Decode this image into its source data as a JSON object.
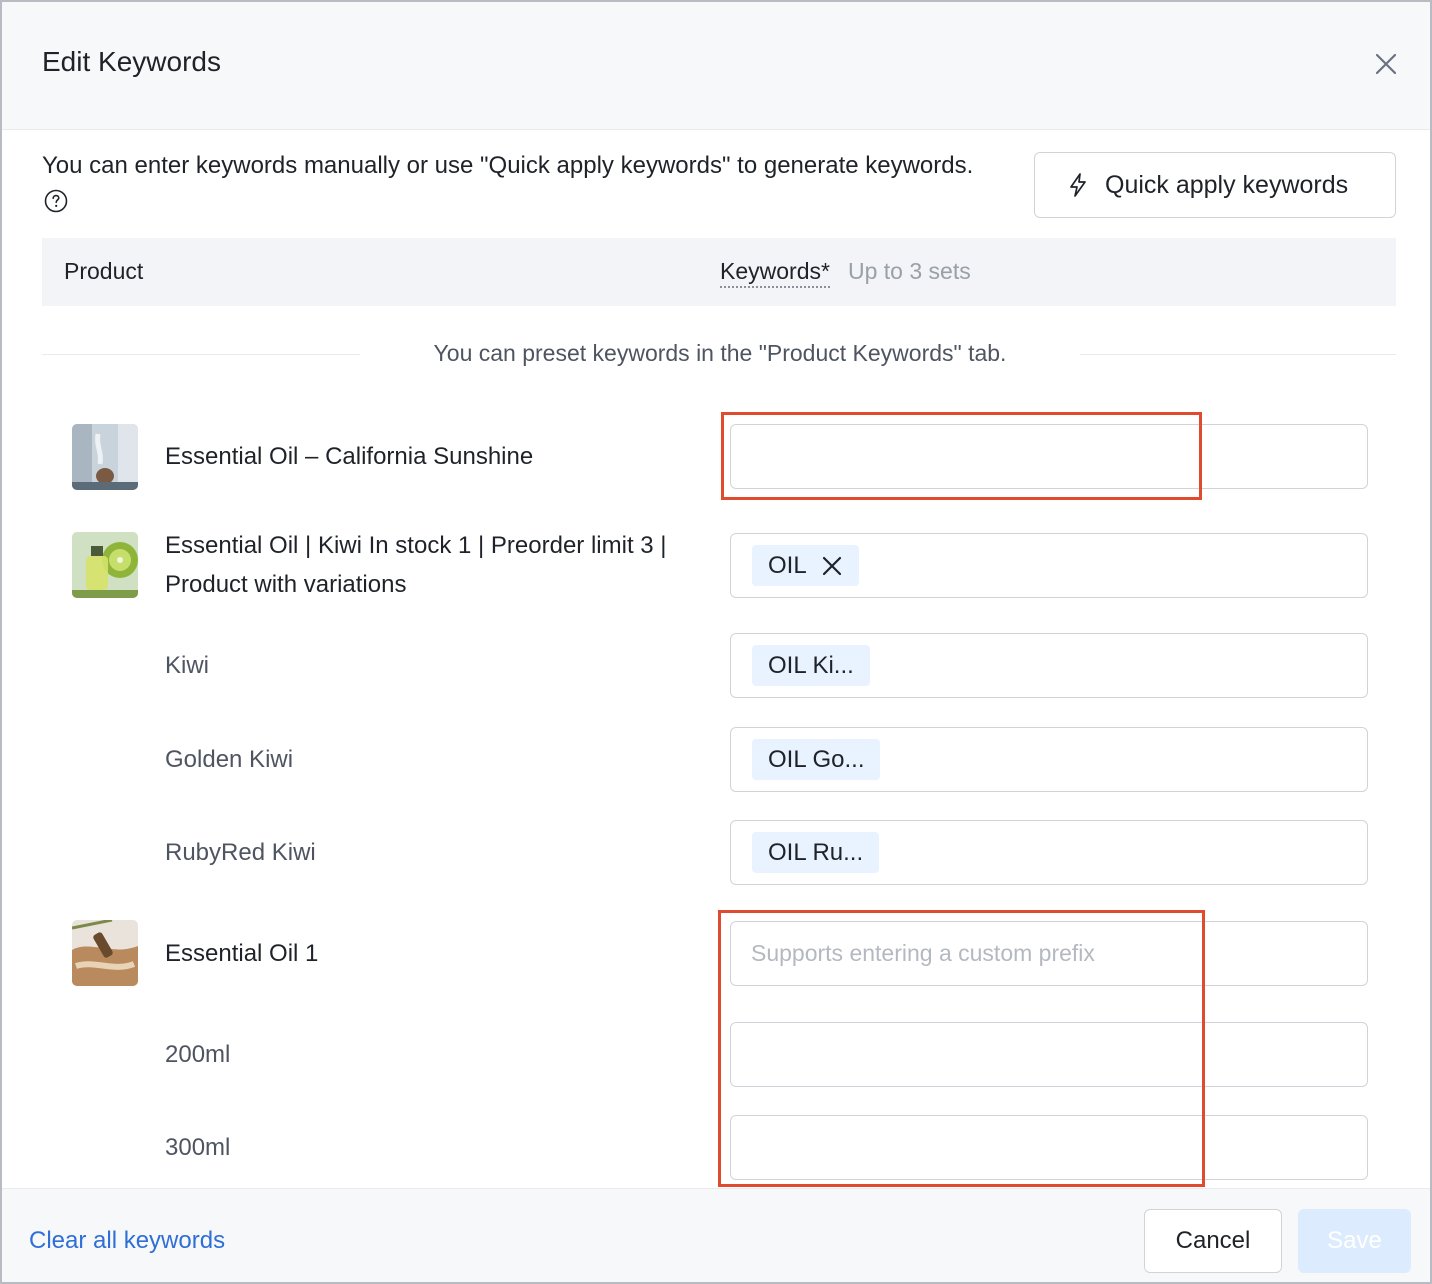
{
  "dialog": {
    "title": "Edit Keywords"
  },
  "intro": {
    "text": "You can enter keywords manually or use \"Quick apply keywords\" to generate keywords."
  },
  "quick_apply": {
    "label": "Quick apply keywords"
  },
  "table": {
    "col_product": "Product",
    "col_keywords": "Keywords*",
    "col_keywords_hint": "Up to 3 sets"
  },
  "divider_text": "You can preset keywords in the \"Product Keywords\" tab.",
  "rows": [
    {
      "name": "Essential Oil – California Sunshine",
      "keyword_value": ""
    },
    {
      "name": "Essential Oil | Kiwi In stock 1 | Preorder limit 3 | Product with variations",
      "tag": "OIL"
    },
    {
      "variant": "Kiwi",
      "tag": "OIL Ki..."
    },
    {
      "variant": "Golden Kiwi",
      "tag": "OIL Go..."
    },
    {
      "variant": "RubyRed Kiwi",
      "tag": "OIL Ru..."
    },
    {
      "name": "Essential Oil 1",
      "placeholder": "Supports entering a custom prefix"
    },
    {
      "variant": "200ml",
      "keyword_value": ""
    },
    {
      "variant": "300ml",
      "keyword_value": ""
    }
  ],
  "footer": {
    "clear_label": "Clear all keywords",
    "cancel_label": "Cancel",
    "save_label": "Save"
  },
  "colors": {
    "highlight": "#e04a2f",
    "link": "#2f6fd6",
    "tag_bg": "#e8f3ff",
    "save_disabled_bg": "#dcebfd"
  }
}
